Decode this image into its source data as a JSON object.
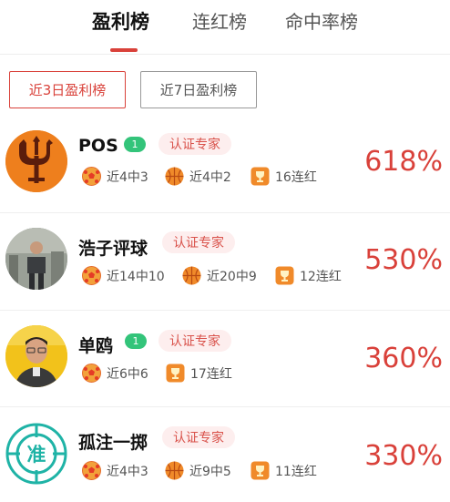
{
  "tabs": [
    {
      "label": "盈利榜",
      "active": true
    },
    {
      "label": "连红榜",
      "active": false
    },
    {
      "label": "命中率榜",
      "active": false
    }
  ],
  "filters": [
    {
      "label": "近3日盈利榜",
      "active": true
    },
    {
      "label": "近7日盈利榜",
      "active": false
    }
  ],
  "colors": {
    "accent": "#d9413a",
    "level_badge": "#33c47a",
    "cert_bg": "#fdeeee"
  },
  "experts": [
    {
      "name": "POS",
      "level": "1",
      "cert": "认证专家",
      "rate": "618%",
      "stats": [
        {
          "icon": "football-icon",
          "text": "近4中3"
        },
        {
          "icon": "basketball-icon",
          "text": "近4中2"
        },
        {
          "icon": "trophy-icon",
          "text": "16连红"
        }
      ]
    },
    {
      "name": "浩子评球",
      "level": "",
      "cert": "认证专家",
      "rate": "530%",
      "stats": [
        {
          "icon": "football-icon",
          "text": "近14中10"
        },
        {
          "icon": "basketball-icon",
          "text": "近20中9"
        },
        {
          "icon": "trophy-icon",
          "text": "12连红"
        }
      ]
    },
    {
      "name": "单鸥",
      "level": "1",
      "cert": "认证专家",
      "rate": "360%",
      "stats": [
        {
          "icon": "football-icon",
          "text": "近6中6"
        },
        {
          "icon": "trophy-icon",
          "text": "17连红"
        }
      ]
    },
    {
      "name": "孤注一掷",
      "level": "",
      "cert": "认证专家",
      "rate": "330%",
      "stats": [
        {
          "icon": "football-icon",
          "text": "近4中3"
        },
        {
          "icon": "basketball-icon",
          "text": "近9中5"
        },
        {
          "icon": "trophy-icon",
          "text": "11连红"
        }
      ]
    }
  ],
  "avatars": [
    {
      "icon": "trident-icon"
    },
    {
      "icon": "person-photo-icon"
    },
    {
      "icon": "person-photo-icon"
    },
    {
      "icon": "target-zhun-icon",
      "glyph": "准"
    }
  ]
}
